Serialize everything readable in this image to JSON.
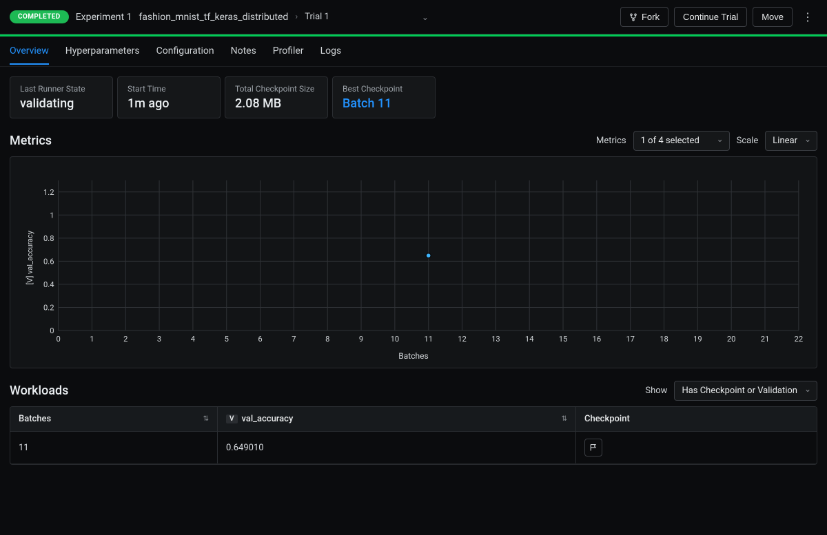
{
  "header": {
    "status": "COMPLETED",
    "experiment_label": "Experiment 1",
    "experiment_name": "fashion_mnist_tf_keras_distributed",
    "trial_label": "Trial 1",
    "buttons": {
      "fork": "Fork",
      "continue": "Continue Trial",
      "move": "Move"
    }
  },
  "tabs": [
    "Overview",
    "Hyperparameters",
    "Configuration",
    "Notes",
    "Profiler",
    "Logs"
  ],
  "active_tab": 0,
  "cards": {
    "last_runner_state": {
      "label": "Last Runner State",
      "value": "validating"
    },
    "start_time": {
      "label": "Start Time",
      "value": "1m ago"
    },
    "ckpt_size": {
      "label": "Total Checkpoint Size",
      "value": "2.08 MB"
    },
    "best_ckpt": {
      "label": "Best Checkpoint",
      "value": "Batch 11"
    }
  },
  "metrics": {
    "title": "Metrics",
    "selector_label": "Metrics",
    "selector_value": "1 of 4 selected",
    "scale_label": "Scale",
    "scale_value": "Linear"
  },
  "chart_data": {
    "type": "scatter",
    "title": "",
    "xlabel": "Batches",
    "ylabel": "[V] val_accuracy",
    "xlim": [
      0,
      22
    ],
    "ylim": [
      0,
      1.3
    ],
    "xticks": [
      0,
      1,
      2,
      3,
      4,
      5,
      6,
      7,
      8,
      9,
      10,
      11,
      12,
      13,
      14,
      15,
      16,
      17,
      18,
      19,
      20,
      21,
      22
    ],
    "yticks": [
      0,
      0.2,
      0.4,
      0.6,
      0.8,
      1,
      1.2
    ],
    "series": [
      {
        "name": "val_accuracy",
        "x": [
          11
        ],
        "y": [
          0.64901
        ]
      }
    ]
  },
  "workloads": {
    "title": "Workloads",
    "show_label": "Show",
    "show_value": "Has Checkpoint or Validation",
    "columns": {
      "batches": "Batches",
      "metric_name": "val_accuracy",
      "metric_tag": "V",
      "checkpoint": "Checkpoint"
    },
    "rows": [
      {
        "batches": "11",
        "val_accuracy": "0.649010"
      }
    ]
  }
}
